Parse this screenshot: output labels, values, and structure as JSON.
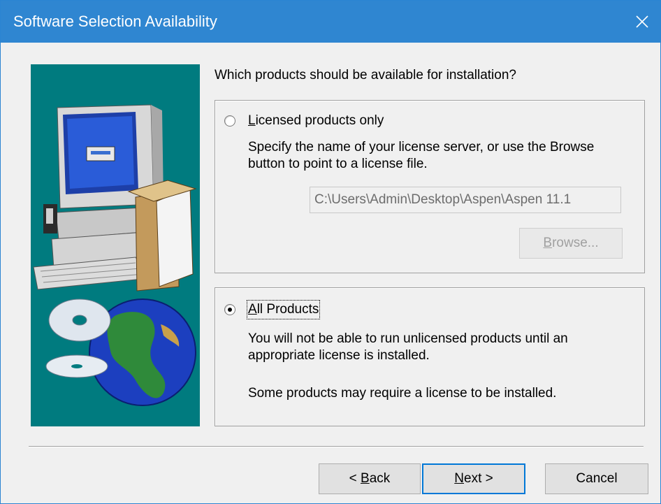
{
  "window": {
    "title": "Software Selection Availability",
    "close_glyph": "✕"
  },
  "question": "Which products should be available for installation?",
  "licensed": {
    "label_first": "L",
    "label_rest": "icensed products only",
    "description_line1": "Specify the name of your license server, or use the Browse",
    "description_line2": "button to point to a license file.",
    "path_value": "C:\\Users\\Admin\\Desktop\\Aspen\\Aspen 11.1",
    "browse_first": "B",
    "browse_rest": "rowse...",
    "selected": false
  },
  "all_products": {
    "label_first": "A",
    "label_rest": "ll Products",
    "description_line1": "You will not be able to run unlicensed products until an",
    "description_line2": "appropriate license is installed.",
    "note": "Some products may require a license to be installed.",
    "selected": true
  },
  "buttons": {
    "back_prefix": "< ",
    "back_first": "B",
    "back_rest": "ack",
    "next_first": "N",
    "next_rest": "ext >",
    "cancel": "Cancel"
  },
  "colors": {
    "titlebar": "#2f86d1",
    "side_panel": "#007b7f",
    "default_button_border": "#0078d7"
  }
}
